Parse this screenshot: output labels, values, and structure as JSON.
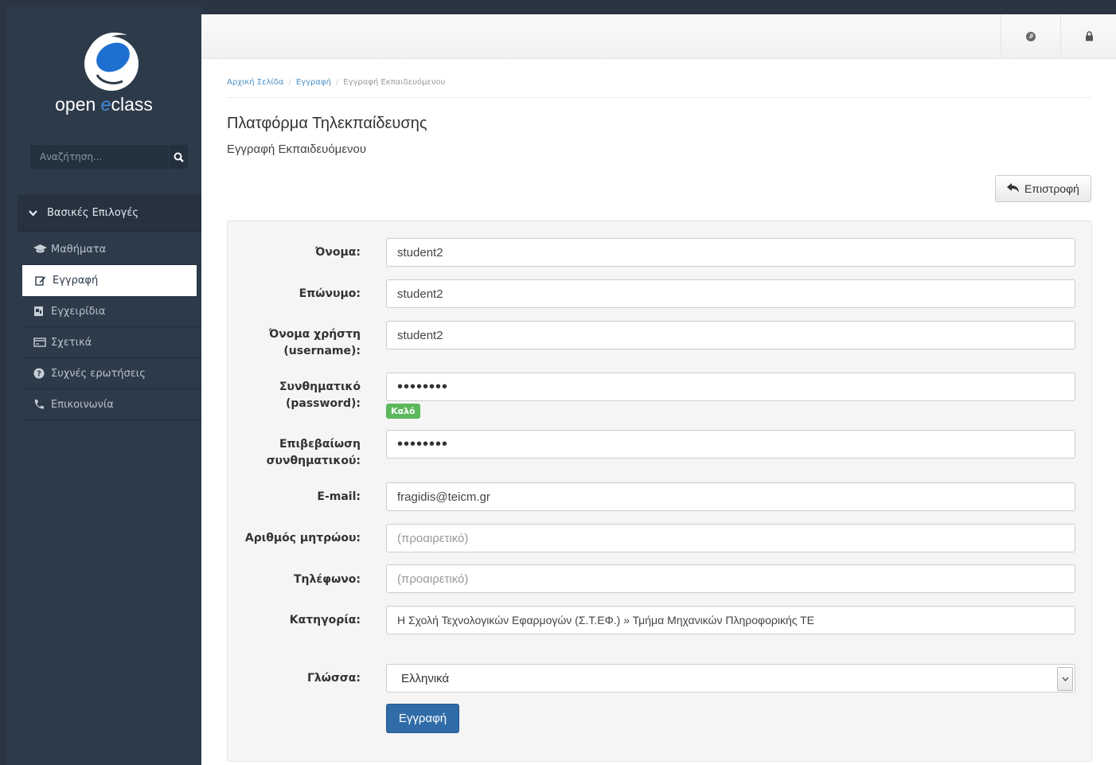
{
  "sidebar": {
    "logo_text_a": "open ",
    "logo_text_b": "e",
    "logo_text_c": "class",
    "search_placeholder": "Αναζήτηση...",
    "section_title": "Βασικές Επιλογές",
    "items": [
      {
        "label": "Μαθήματα",
        "icon": "graduation-cap-icon"
      },
      {
        "label": "Εγγραφή",
        "icon": "edit-icon",
        "active": true
      },
      {
        "label": "Εγχειρίδια",
        "icon": "manual-icon"
      },
      {
        "label": "Σχετικά",
        "icon": "card-icon"
      },
      {
        "label": "Συχνές ερωτήσεις",
        "icon": "question-circle-icon"
      },
      {
        "label": "Επικοινωνία",
        "icon": "phone-icon"
      }
    ]
  },
  "breadcrumb": {
    "home": "Αρχική Σελίδα",
    "register": "Εγγραφή",
    "current": "Εγγραφή Εκπαιδευόμενου"
  },
  "page": {
    "title": "Πλατφόρμα Τηλεκπαίδευσης",
    "subtitle": "Εγγραφή Εκπαιδευόμενου",
    "back_label": "Επιστροφή"
  },
  "form": {
    "first_name_label": "Όνομα:",
    "first_name": "student2",
    "last_name_label": "Επώνυμο:",
    "last_name": "student2",
    "username_label_1": "Όνομα χρήστη",
    "username_label_2": "(username):",
    "username": "student2",
    "password_label_1": "Συνθηματικό",
    "password_label_2": "(password):",
    "password_mask": "••••••••",
    "password_strength": "Καλό",
    "confirm_label_1": "Επιβεβαίωση",
    "confirm_label_2": "συνθηματικού:",
    "confirm_mask": "••••••••",
    "email_label": "E-mail:",
    "email": "fragidis@teicm.gr",
    "am_label": "Αριθμός μητρώου:",
    "am_placeholder": "(προαιρετικό)",
    "phone_label": "Τηλέφωνο:",
    "phone_placeholder": "(προαιρετικό)",
    "category_label": "Κατηγορία:",
    "category": "Η Σχολή Τεχνολογικών Εφαρμογών (Σ.Τ.ΕΦ.) » Τμήμα Μηχανικών Πληροφορικής ΤΕ",
    "language_label": "Γλώσσα:",
    "language": "Ελληνικά",
    "submit_label": "Εγγραφή"
  },
  "colors": {
    "sidebar_bg": "#2d3a49",
    "accent": "#2f6ca8",
    "strength_good": "#5cb85c",
    "link": "#4a90c4"
  }
}
